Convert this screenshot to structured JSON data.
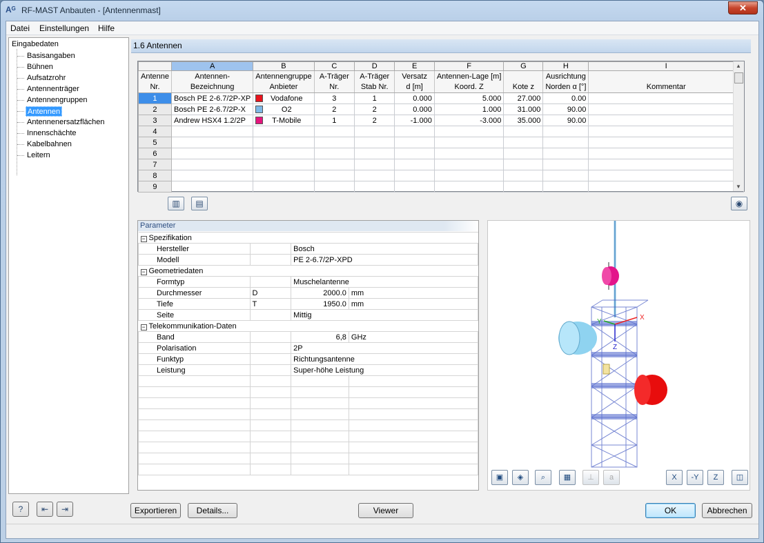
{
  "window": {
    "title": "RF-MAST Anbauten - [Antennenmast]",
    "close": "✕"
  },
  "menu": [
    "Datei",
    "Einstellungen",
    "Hilfe"
  ],
  "nav": {
    "root": "Eingabedaten",
    "items": [
      "Basisangaben",
      "Bühnen",
      "Aufsatzrohr",
      "Antennenträger",
      "Antennengruppen",
      "Antennen",
      "Antennenersatzflächen",
      "Innenschächte",
      "Kabelbahnen",
      "Leitern"
    ],
    "selected": "Antennen"
  },
  "panel": {
    "title": "1.6 Antennen"
  },
  "grid": {
    "letters": [
      "A",
      "B",
      "C",
      "D",
      "E",
      "F",
      "G",
      "H",
      "I"
    ],
    "header_row1": [
      "Antenne",
      "Antennen-",
      "Antennengruppe",
      "A-Träger",
      "A-Träger",
      "Versatz",
      "Antennen-Lage [m]",
      "",
      "Ausrichtung",
      ""
    ],
    "header_row2": [
      "Nr.",
      "Bezeichnung",
      "Anbieter",
      "Nr.",
      "Stab Nr.",
      "d [m]",
      "Koord. Z",
      "Kote z",
      "Norden α [°]",
      "Kommentar"
    ],
    "rows": [
      {
        "nr": "1",
        "name": "Bosch PE 2-6.7/2P-XP",
        "color": "#e8141e",
        "provider": "Vodafone",
        "traeger": "3",
        "stab": "1",
        "versatz": "0.000",
        "koord": "5.000",
        "kote": "27.000",
        "ausr": "0.00",
        "kommentar": ""
      },
      {
        "nr": "2",
        "name": "Bosch PE 2-6.7/2P-X",
        "color": "#7db8e6",
        "provider": "O2",
        "traeger": "2",
        "stab": "2",
        "versatz": "0.000",
        "koord": "1.000",
        "kote": "31.000",
        "ausr": "90.00",
        "kommentar": ""
      },
      {
        "nr": "3",
        "name": "Andrew HSX4 1.2/2P",
        "color": "#e4157d",
        "provider": "T-Mobile",
        "traeger": "1",
        "stab": "2",
        "versatz": "-1.000",
        "koord": "-3.000",
        "kote": "35.000",
        "ausr": "90.00",
        "kommentar": ""
      },
      {
        "nr": "4"
      },
      {
        "nr": "5"
      },
      {
        "nr": "6"
      },
      {
        "nr": "7"
      },
      {
        "nr": "8"
      },
      {
        "nr": "9"
      }
    ]
  },
  "params": {
    "title": "Parameter",
    "groups": [
      {
        "name": "Spezifikation",
        "rows": [
          {
            "label": "Hersteller",
            "sym": "",
            "value": "Bosch",
            "unit": ""
          },
          {
            "label": "Modell",
            "sym": "",
            "value": "PE 2-6.7/2P-XPD",
            "unit": ""
          }
        ]
      },
      {
        "name": "Geometriedaten",
        "rows": [
          {
            "label": "Formtyp",
            "sym": "",
            "value": "Muschelantenne",
            "unit": ""
          },
          {
            "label": "Durchmesser",
            "sym": "D",
            "value": "2000.0",
            "unit": "mm"
          },
          {
            "label": "Tiefe",
            "sym": "T",
            "value": "1950.0",
            "unit": "mm"
          },
          {
            "label": "Seite",
            "sym": "",
            "value": "Mittig",
            "unit": ""
          }
        ]
      },
      {
        "name": "Telekommunikation-Daten",
        "rows": [
          {
            "label": "Band",
            "sym": "",
            "value": "6,8",
            "unit": "GHz"
          },
          {
            "label": "Polarisation",
            "sym": "",
            "value": "2P",
            "unit": ""
          },
          {
            "label": "Funktyp",
            "sym": "",
            "value": "Richtungsantenne",
            "unit": ""
          },
          {
            "label": "Leistung",
            "sym": "",
            "value": "Super-höhe Leistung",
            "unit": ""
          }
        ]
      }
    ]
  },
  "viewer": {
    "axis_x": "X",
    "axis_y": "Y",
    "axis_z": "Z"
  },
  "buttons": {
    "export": "Exportieren",
    "details": "Details...",
    "viewer": "Viewer",
    "ok": "OK",
    "cancel": "Abbrechen"
  }
}
